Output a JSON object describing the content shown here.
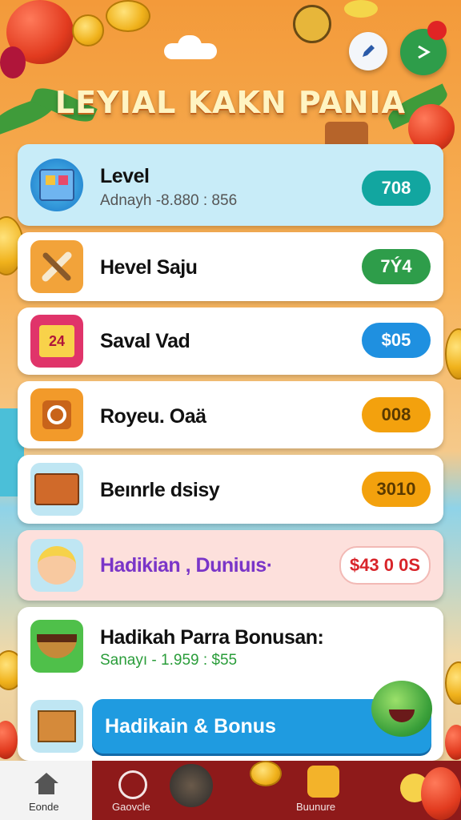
{
  "header": {
    "title": "LEYIAL KAKN PANIA",
    "edit_icon": "pencil-icon",
    "next_icon": "arrow-icon"
  },
  "rows": [
    {
      "title": "Level",
      "subtitle": "Adnayh -8.880 : 856",
      "value": "708",
      "icon": "blocks-icon",
      "pill_color": "#12a6a0"
    },
    {
      "title": "Hevel Saju",
      "value": "7Ý4",
      "icon": "tools-icon",
      "pill_color": "#2e9d4a"
    },
    {
      "title": "Saval Vad",
      "value": "$05",
      "icon": "calendar-gift-icon",
      "pill_color": "#1f90e0"
    },
    {
      "title": "Royeu. Oaä",
      "value": "008",
      "icon": "ring-icon",
      "pill_color": "#f3a10d"
    },
    {
      "title": "Beınrle dsisy",
      "value": "3010",
      "icon": "treasure-chest-icon",
      "pill_color": "#f3a10d"
    },
    {
      "title": "Hadikian , Duniuıs·",
      "value": "$43 0 0S",
      "icon": "character-face-icon",
      "pill_color": "#ffffff"
    },
    {
      "title": "Hadikah Parra Bonusan:",
      "subtitle": "Sanayı - 1.959 : $55",
      "icon": "food-bowl-icon"
    }
  ],
  "bonus_button": {
    "label": "Hadikain & Bonus",
    "icon": "crate-icon",
    "mascot": "smiling-fruit-icon"
  },
  "bottom_nav": {
    "home_label": "Eonde",
    "mid_label": "Gaovcle",
    "right_label": "Buunure"
  },
  "colors": {
    "highlight_row": "#c8ecf8",
    "pink_row": "#fde0dc",
    "bonus_blue": "#1f9be0",
    "purple_text": "#7a35c8",
    "green_text": "#2a9d3a"
  }
}
